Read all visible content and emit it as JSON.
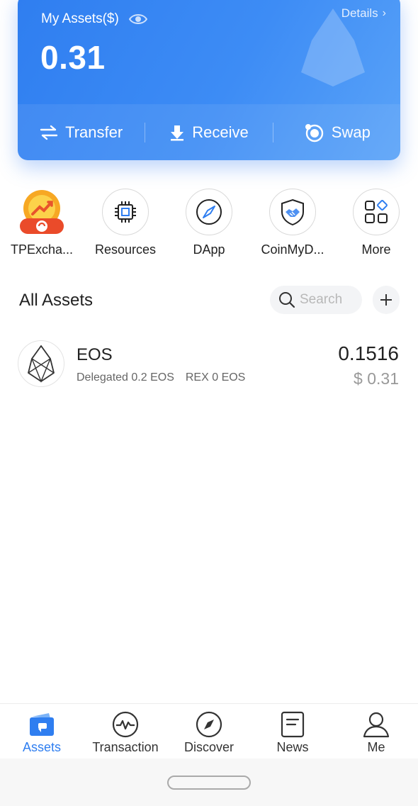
{
  "card": {
    "label": "My Assets($)",
    "details": "Details",
    "amount": "0.31",
    "actions": [
      {
        "label": "Transfer",
        "icon": "transfer-icon"
      },
      {
        "label": "Receive",
        "icon": "receive-icon"
      },
      {
        "label": "Swap",
        "icon": "swap-icon"
      }
    ]
  },
  "shortcuts": [
    {
      "label": "TPExcha...",
      "icon": "tpexchange-icon"
    },
    {
      "label": "Resources",
      "icon": "chip-icon"
    },
    {
      "label": "DApp",
      "icon": "compass-icon"
    },
    {
      "label": "CoinMyD...",
      "icon": "shield-handshake-icon"
    },
    {
      "label": "More",
      "icon": "grid-icon"
    }
  ],
  "assets": {
    "title": "All Assets",
    "search_placeholder": "Search"
  },
  "tokens": [
    {
      "symbol": "EOS",
      "delegated": "Delegated 0.2 EOS",
      "rex": "REX 0 EOS",
      "balance": "0.1516",
      "usd": "$ 0.31"
    }
  ],
  "tabs": [
    {
      "label": "Assets",
      "icon": "wallet-icon",
      "active": true
    },
    {
      "label": "Transaction",
      "icon": "pulse-icon",
      "active": false
    },
    {
      "label": "Discover",
      "icon": "compass-icon",
      "active": false
    },
    {
      "label": "News",
      "icon": "news-icon",
      "active": false
    },
    {
      "label": "Me",
      "icon": "person-icon",
      "active": false
    }
  ],
  "colors": {
    "accent": "#2f7ef0",
    "card_gradient_start": "#2f7ef0",
    "card_gradient_end": "#5aa3f8"
  }
}
